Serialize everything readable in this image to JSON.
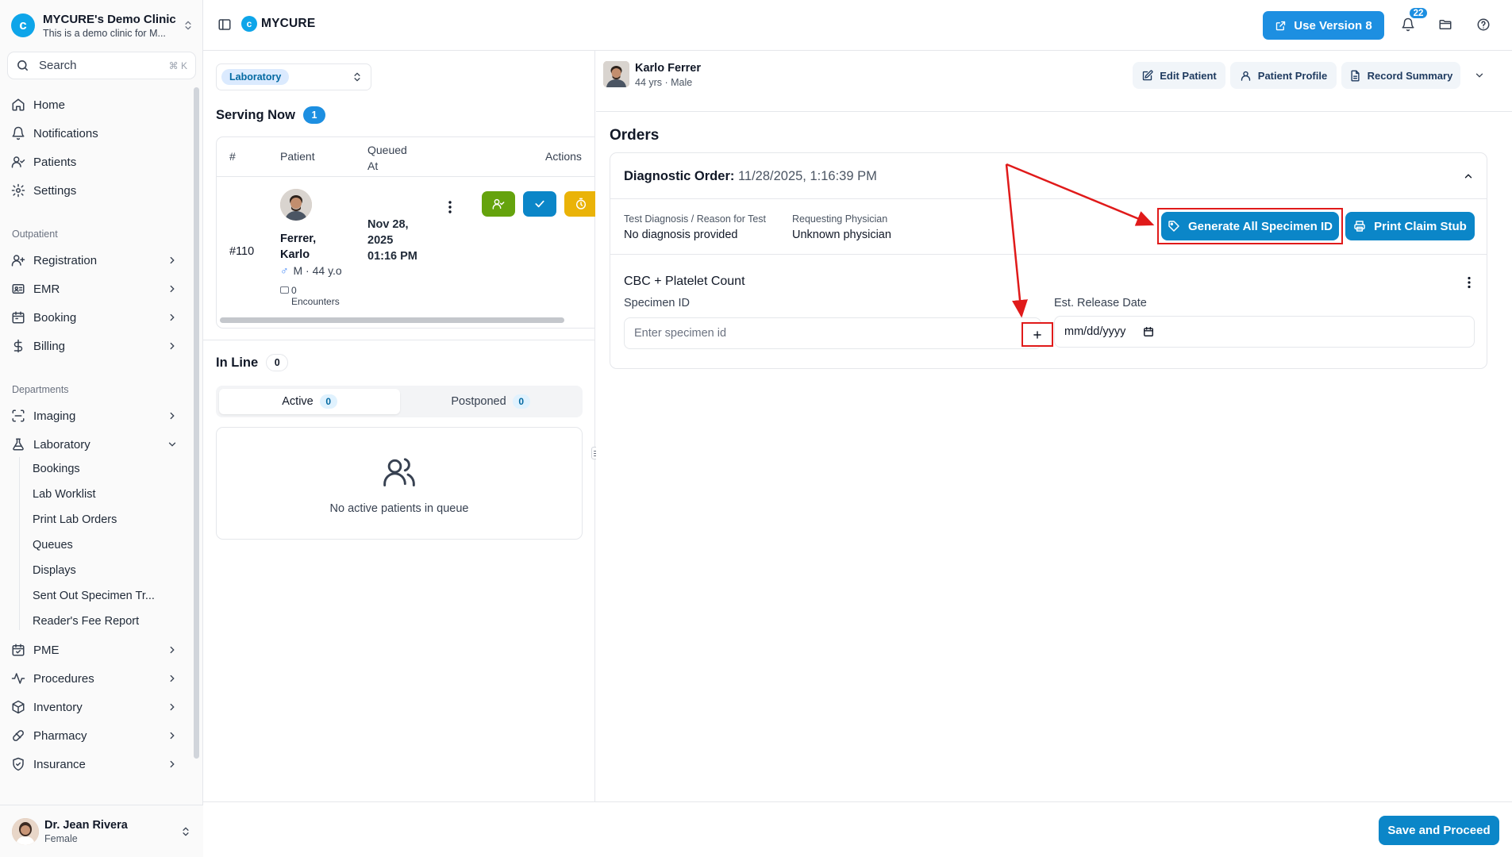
{
  "sidebar": {
    "clinic_name": "MYCURE's Demo Clinic",
    "clinic_sub": "This is a demo clinic for M...",
    "search_label": "Search",
    "search_shortcut": "⌘ K",
    "main_nav": [
      {
        "label": "Home",
        "icon": "home-icon"
      },
      {
        "label": "Notifications",
        "icon": "bell-icon"
      },
      {
        "label": "Patients",
        "icon": "users-icon"
      },
      {
        "label": "Settings",
        "icon": "gear-icon"
      }
    ],
    "section_outpatient": "Outpatient",
    "outpatient": [
      {
        "label": "Registration",
        "icon": "user-plus-icon"
      },
      {
        "label": "EMR",
        "icon": "record-icon"
      },
      {
        "label": "Booking",
        "icon": "calendar-icon"
      },
      {
        "label": "Billing",
        "icon": "dollar-icon"
      }
    ],
    "section_departments": "Departments",
    "departments": [
      {
        "label": "Imaging",
        "icon": "scan-icon"
      },
      {
        "label": "Laboratory",
        "icon": "flask-icon",
        "expanded": true
      }
    ],
    "laboratory_sub": [
      "Bookings",
      "Lab Worklist",
      "Print Lab Orders",
      "Queues",
      "Displays",
      "Sent Out Specimen Tr...",
      "Reader's Fee Report"
    ],
    "departments_more": [
      {
        "label": "PME",
        "icon": "calendar-check-icon"
      },
      {
        "label": "Procedures",
        "icon": "activity-icon"
      },
      {
        "label": "Inventory",
        "icon": "box-icon"
      },
      {
        "label": "Pharmacy",
        "icon": "pill-icon"
      },
      {
        "label": "Insurance",
        "icon": "shield-icon"
      }
    ],
    "user": {
      "name": "Dr. Jean Rivera",
      "sub": "Female"
    }
  },
  "topbar": {
    "brand": "MYCURE",
    "use_version_label": "Use Version 8",
    "notification_count": "22"
  },
  "queue": {
    "department": "Laboratory",
    "serving_now_label": "Serving Now",
    "serving_count": "1",
    "columns": [
      "#",
      "Patient",
      "Queued At",
      "Actions"
    ],
    "row": {
      "number": "#110",
      "patient_name": "Ferrer, Karlo",
      "sex_symbol": "♂",
      "sex_age": "M · 44 y.o",
      "encounters": "0 Encounters",
      "queued_at": "Nov 28, 2025 01:16 PM"
    },
    "in_line_label": "In Line",
    "in_line_count": "0",
    "tabs": [
      {
        "label": "Active",
        "count": "0"
      },
      {
        "label": "Postponed",
        "count": "0"
      }
    ],
    "empty_text": "No active patients in queue"
  },
  "patient": {
    "name": "Karlo Ferrer",
    "sub": "44 yrs · Male",
    "edit_label": "Edit Patient",
    "profile_label": "Patient Profile",
    "summary_label": "Record Summary"
  },
  "orders": {
    "title": "Orders",
    "order_label": "Diagnostic Order:",
    "order_datetime": "11/28/2025, 1:16:39 PM",
    "diagnosis_label": "Test Diagnosis / Reason for Test",
    "diagnosis_value": "No diagnosis provided",
    "physician_label": "Requesting Physician",
    "physician_value": "Unknown physician",
    "generate_label": "Generate All Specimen ID",
    "print_label": "Print Claim Stub",
    "test_name": "CBC + Platelet Count",
    "specimen_label": "Specimen ID",
    "specimen_placeholder": "Enter specimen id",
    "release_label": "Est. Release Date",
    "release_placeholder": "mm/dd/yyyy"
  },
  "footer": {
    "save_label": "Save and Proceed"
  },
  "colors": {
    "primary": "#0b86c8",
    "accent": "#1d8fe1",
    "annotation": "#e01a1a"
  }
}
